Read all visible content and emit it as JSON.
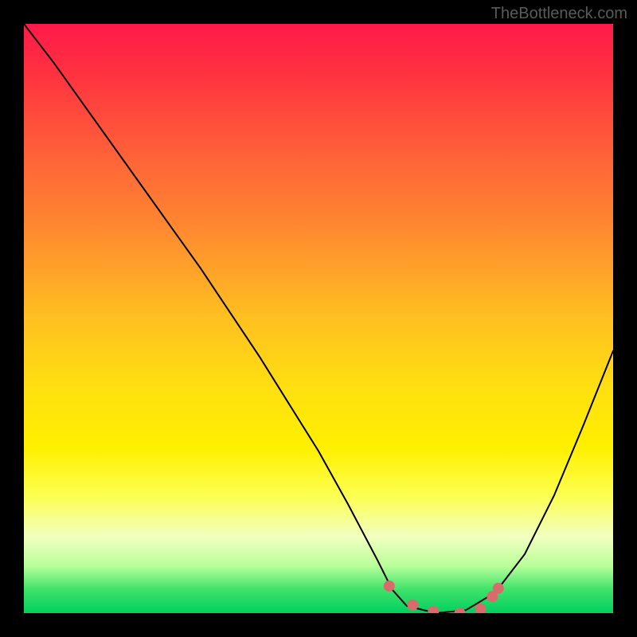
{
  "watermark": "TheBottleneck.com",
  "chart_data": {
    "type": "line",
    "title": "",
    "xlabel": "",
    "ylabel": "",
    "xlim": [
      0,
      1
    ],
    "ylim": [
      0,
      1
    ],
    "series": [
      {
        "name": "curve",
        "x": [
          0.0,
          0.05,
          0.1,
          0.15,
          0.2,
          0.25,
          0.3,
          0.35,
          0.4,
          0.45,
          0.5,
          0.55,
          0.6,
          0.625,
          0.65,
          0.7,
          0.75,
          0.8,
          0.85,
          0.9,
          0.95,
          1.0
        ],
        "y": [
          1.0,
          0.935,
          0.865,
          0.795,
          0.725,
          0.655,
          0.585,
          0.51,
          0.435,
          0.355,
          0.275,
          0.185,
          0.09,
          0.04,
          0.012,
          0.0,
          0.005,
          0.035,
          0.1,
          0.2,
          0.32,
          0.445
        ]
      },
      {
        "name": "highlight-dots",
        "x": [
          0.62,
          0.66,
          0.695,
          0.74,
          0.775,
          0.795,
          0.805
        ],
        "y": [
          0.046,
          0.014,
          0.003,
          0.0,
          0.007,
          0.028,
          0.042
        ]
      }
    ],
    "colors": {
      "curve": "#000000",
      "highlight": "#d96b6b"
    }
  }
}
